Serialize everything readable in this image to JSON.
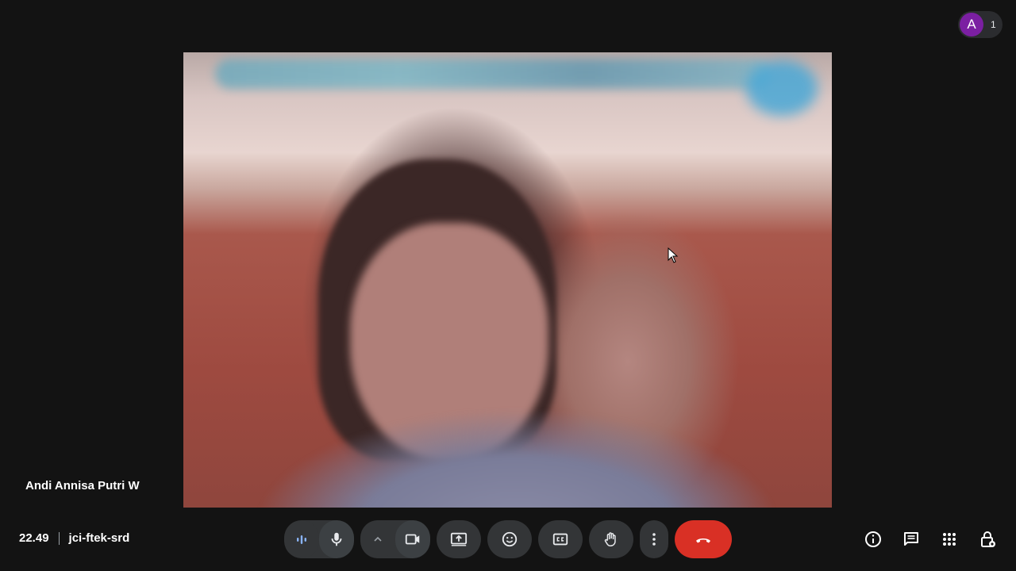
{
  "meeting": {
    "time": "22.49",
    "code": "jci-ftek-srd"
  },
  "participant": {
    "name": "Andi Annisa Putri W"
  },
  "top_right": {
    "avatar_letter": "A",
    "participant_count": "1",
    "avatar_color": "#7b1fa2"
  },
  "controls": {
    "buttons": [
      {
        "name": "audio-levels-icon"
      },
      {
        "name": "microphone-icon"
      },
      {
        "name": "chevron-up-icon"
      },
      {
        "name": "camera-icon"
      },
      {
        "name": "present-screen-icon"
      },
      {
        "name": "emoji-icon"
      },
      {
        "name": "captions-icon"
      },
      {
        "name": "raise-hand-icon"
      },
      {
        "name": "more-options-icon"
      },
      {
        "name": "end-call-icon"
      }
    ],
    "end_call_color": "#d93025"
  },
  "right_controls": [
    {
      "name": "info-icon"
    },
    {
      "name": "chat-icon"
    },
    {
      "name": "activities-icon"
    },
    {
      "name": "host-controls-icon"
    }
  ]
}
